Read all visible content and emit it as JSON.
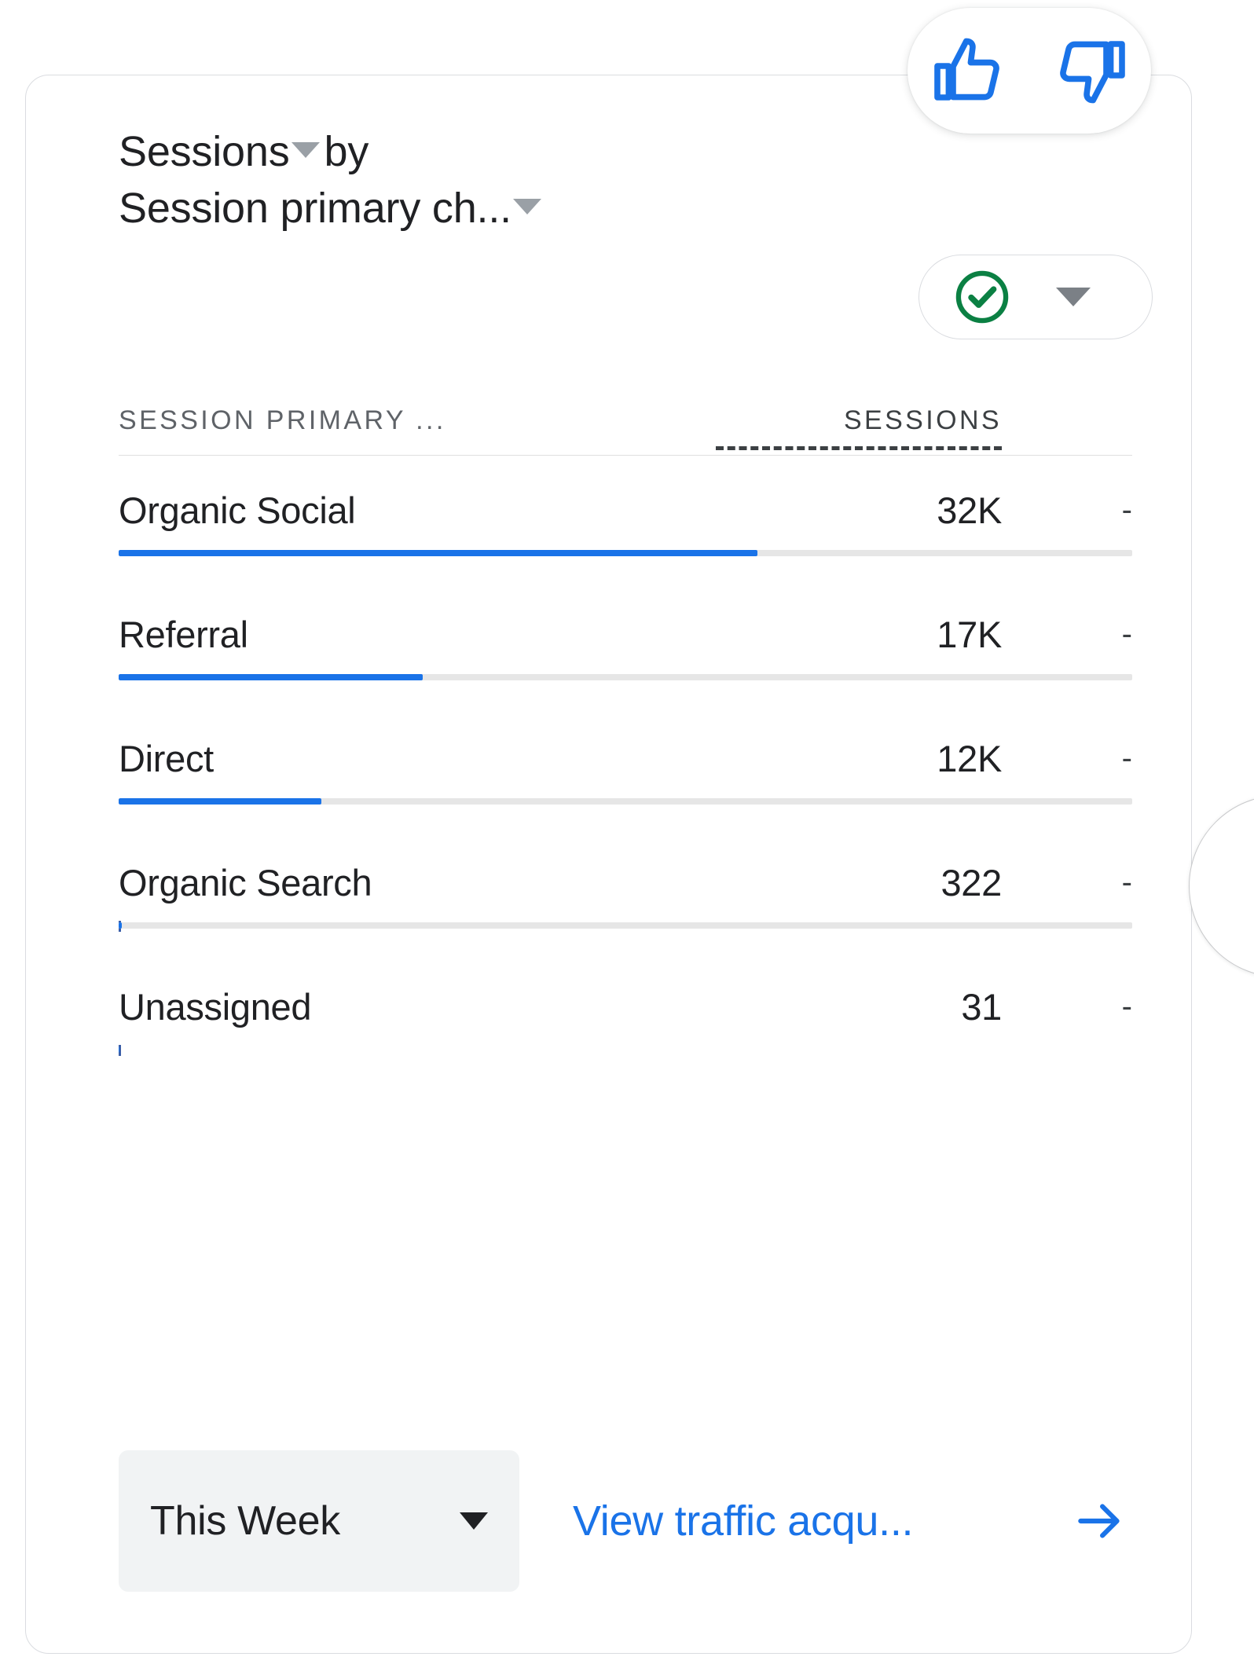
{
  "feedback": {
    "thumbs_up_icon": "thumb-up-icon",
    "thumbs_down_icon": "thumb-down-icon"
  },
  "header": {
    "metric_label": "Sessions",
    "connector": "by",
    "dimension_label": "Session primary ch...",
    "metric_caret_icon": "chevron-down-icon",
    "dimension_caret_icon": "chevron-down-icon"
  },
  "status_chip": {
    "status_icon": "check-circle-icon",
    "status_color": "#0b8043",
    "caret_icon": "chevron-down-icon"
  },
  "table": {
    "columns": {
      "dimension": "SESSION PRIMARY ...",
      "metric": "SESSIONS",
      "extra": ""
    },
    "rows": [
      {
        "label": "Organic Social",
        "value": "32K",
        "extra": "-",
        "bar_percent": 63,
        "has_track": true
      },
      {
        "label": "Referral",
        "value": "17K",
        "extra": "-",
        "bar_percent": 30,
        "has_track": true
      },
      {
        "label": "Direct",
        "value": "12K",
        "extra": "-",
        "bar_percent": 20,
        "has_track": true
      },
      {
        "label": "Organic Search",
        "value": "322",
        "extra": "-",
        "bar_percent": 0.3,
        "has_track": true
      },
      {
        "label": "Unassigned",
        "value": "31",
        "extra": "-",
        "bar_percent": 0.1,
        "has_track": false
      }
    ]
  },
  "footer": {
    "date_range_label": "This Week",
    "date_range_caret_icon": "chevron-down-icon",
    "link_label": "View traffic acqu...",
    "link_arrow_icon": "arrow-right-icon"
  },
  "colors": {
    "accent_blue": "#1a73e8",
    "bar_blue": "#1a73e8",
    "check_green": "#0b8043",
    "text_primary": "#202124",
    "text_secondary": "#5f6368",
    "card_border": "#dadce0",
    "chip_bg": "#f1f3f4"
  },
  "chart_data": {
    "type": "bar",
    "title": "Sessions by Session primary channel group",
    "categories": [
      "Organic Social",
      "Referral",
      "Direct",
      "Organic Search",
      "Unassigned"
    ],
    "values": [
      32000,
      17000,
      12000,
      322,
      31
    ],
    "value_labels": [
      "32K",
      "17K",
      "12K",
      "322",
      "31"
    ],
    "xlabel": "Sessions",
    "ylabel": "Session primary channel group",
    "orientation": "horizontal",
    "grid": false,
    "legend": false,
    "max_value": 32000
  }
}
